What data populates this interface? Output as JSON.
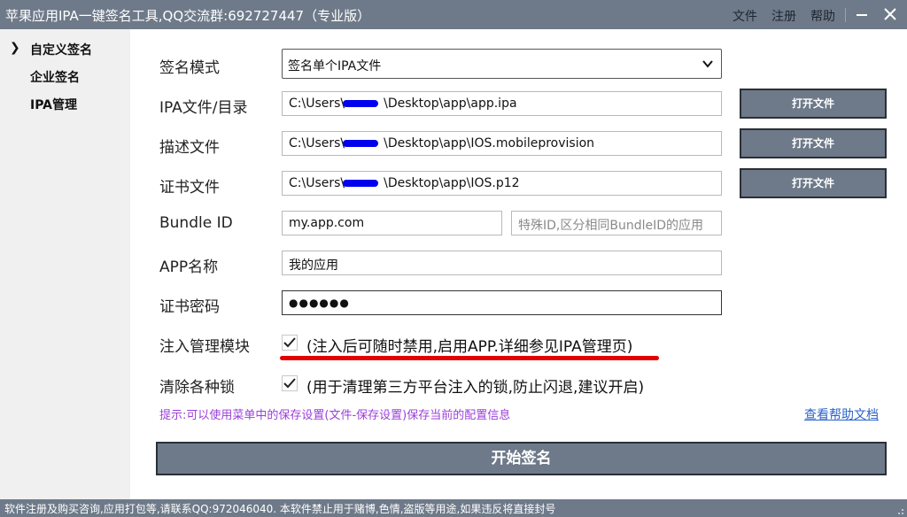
{
  "app": {
    "title": "苹果应用IPA一键签名工具,QQ交流群:692727447（专业版）",
    "menu": [
      "文件",
      "注册",
      "帮助"
    ]
  },
  "sidebar": {
    "items": [
      {
        "label": "自定义签名",
        "selected": true
      },
      {
        "label": "企业签名",
        "selected": false
      },
      {
        "label": "IPA管理",
        "selected": false
      }
    ]
  },
  "form": {
    "sign_mode": {
      "label": "签名模式",
      "value": "签名单个IPA文件"
    },
    "ipa": {
      "label": "IPA文件/目录",
      "prefix": "C:\\Users\\",
      "suffix": "\\Desktop\\app\\app.ipa",
      "button": "打开文件"
    },
    "profile": {
      "label": "描述文件",
      "prefix": "C:\\Users\\",
      "suffix": "\\Desktop\\app\\IOS.mobileprovision",
      "button": "打开文件"
    },
    "cert": {
      "label": "证书文件",
      "prefix": "C:\\Users\\",
      "suffix": "\\Desktop\\app\\IOS.p12",
      "button": "打开文件"
    },
    "bundle": {
      "label": "Bundle ID",
      "value": "my.app.com",
      "extra_placeholder": "特殊ID,区分相同BundleID的应用"
    },
    "app_name": {
      "label": "APP名称",
      "value": "我的应用"
    },
    "password": {
      "label": "证书密码",
      "value": "●●●●●●"
    },
    "inject": {
      "label": "注入管理模块",
      "checked": true,
      "text": "(注入后可随时禁用,启用APP.详细参见IPA管理页)"
    },
    "clear_locks": {
      "label": "清除各种锁",
      "checked": true,
      "text": "(用于清理第三方平台注入的锁,防止闪退,建议开启)"
    }
  },
  "hint": "提示:可以使用菜单中的保存设置(文件-保存设置)保存当前的配置信息",
  "help_link": "查看帮助文档",
  "start_button": "开始签名",
  "statusbar": "软件注册及购买咨询,应用打包等,请联系QQ:972046040.  本软件禁止用于赌博,色情,盗版等用途,如果违反将直接封号",
  "colors": {
    "accent": "#6e7a89",
    "hint": "#9b3fd8",
    "link": "#2d63c8",
    "underline": "#e30000",
    "redaction": "#0000ee"
  }
}
